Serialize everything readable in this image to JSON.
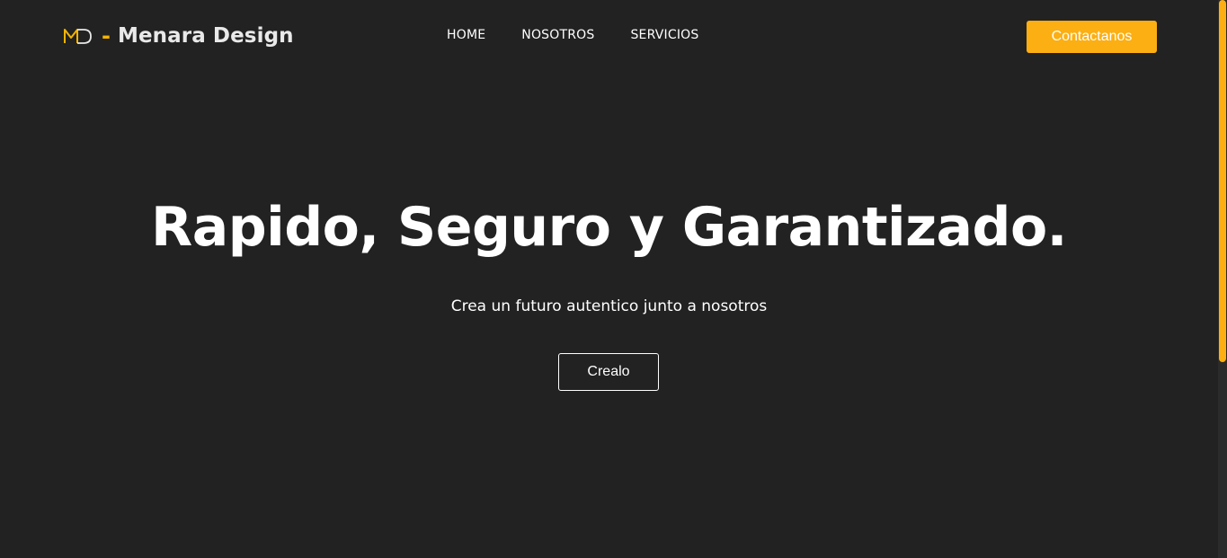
{
  "brand": {
    "logo_icon": "md-monogram-icon",
    "dash": "-",
    "name": "Menara Design"
  },
  "nav": {
    "items": [
      {
        "label": "HOME"
      },
      {
        "label": "NOSOTROS"
      },
      {
        "label": "SERVICIOS"
      }
    ]
  },
  "header": {
    "contact_label": "Contactanos"
  },
  "hero": {
    "title": "Rapido, Seguro y Garantizado.",
    "subtitle": "Crea un futuro autentico junto a nosotros",
    "cta_label": "Crealo"
  },
  "colors": {
    "background": "#222222",
    "accent": "#fcaf12",
    "text": "#ffffff"
  }
}
